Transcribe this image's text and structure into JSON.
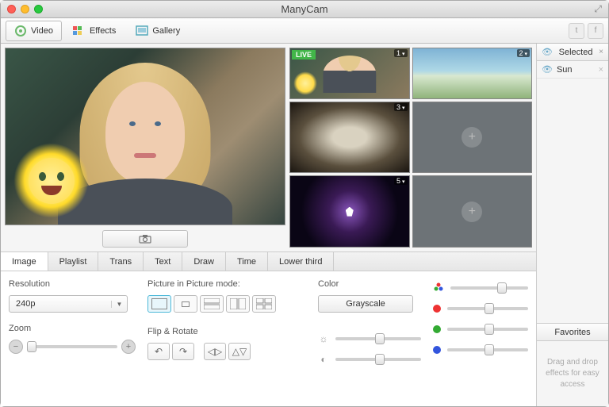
{
  "window": {
    "title": "ManyCam"
  },
  "toolbar": {
    "video": "Video",
    "effects": "Effects",
    "gallery": "Gallery"
  },
  "sources": {
    "live": "LIVE",
    "thumbs": [
      "1",
      "2",
      "3",
      "",
      "5",
      ""
    ]
  },
  "tabs": {
    "image": "Image",
    "playlist": "Playlist",
    "trans": "Trans",
    "text": "Text",
    "draw": "Draw",
    "time": "Time",
    "lower": "Lower third"
  },
  "controls": {
    "resolution_label": "Resolution",
    "resolution_value": "240p",
    "zoom_label": "Zoom",
    "pip_label": "Picture in Picture mode:",
    "flip_label": "Flip & Rotate",
    "color_label": "Color",
    "grayscale": "Grayscale"
  },
  "sidebar": {
    "selected": "Selected",
    "effect_name": "Sun",
    "favorites": "Favorites",
    "hint": "Drag and drop effects for easy access"
  }
}
